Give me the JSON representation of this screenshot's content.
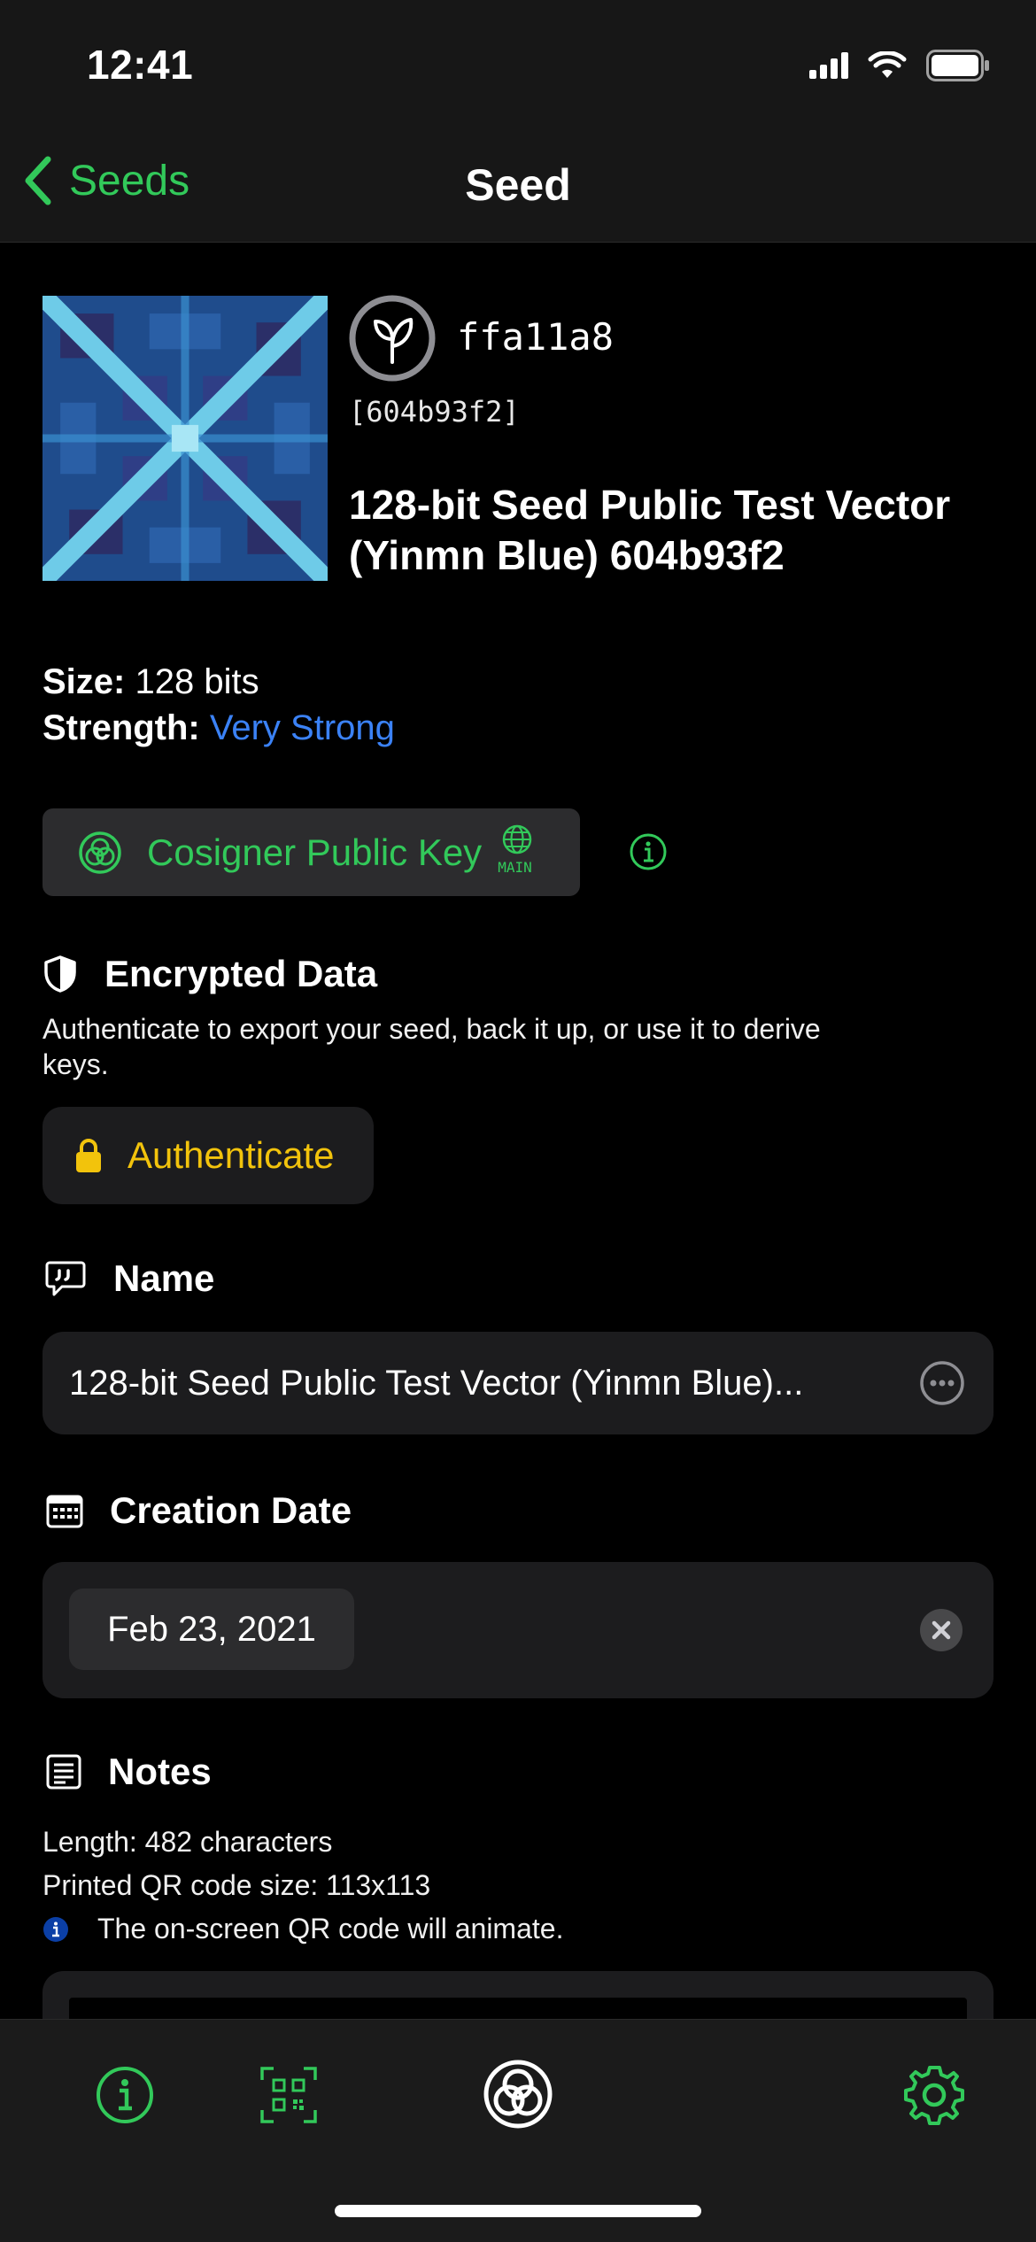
{
  "status_bar": {
    "time": "12:41"
  },
  "nav": {
    "back_label": "Seeds",
    "title": "Seed"
  },
  "seed": {
    "fingerprint": "ffa11a8",
    "id": "[604b93f2]",
    "title": "128-bit Seed Public Test Vector (Yinmn Blue) 604b93f2"
  },
  "info": {
    "size_label": "Size:",
    "size_value": "128 bits",
    "strength_label": "Strength:",
    "strength_value": "Very Strong"
  },
  "cosigner": {
    "label": "Cosigner Public Key",
    "network_badge": "MAIN"
  },
  "encrypted": {
    "heading": "Encrypted Data",
    "description": "Authenticate to export your seed, back it up, or use it to derive keys.",
    "auth_label": "Authenticate"
  },
  "name_section": {
    "heading": "Name",
    "value": "128-bit Seed Public Test Vector (Yinmn Blue)..."
  },
  "date_section": {
    "heading": "Creation Date",
    "value": "Feb 23, 2021"
  },
  "notes_section": {
    "heading": "Notes",
    "length": "Length: 482 characters",
    "qr_size": "Printed QR code size: 113x113",
    "hint": "The on-screen QR code will animate."
  },
  "colors": {
    "accent_green": "#32c95a",
    "strength_blue": "#3b82f6",
    "auth_yellow": "#f2c30c",
    "field_bg": "#1c1c1e"
  },
  "tab_bar": {
    "items": [
      "info-icon",
      "qr-code-icon",
      "blockchain-commons-logo",
      "gear-icon"
    ]
  }
}
